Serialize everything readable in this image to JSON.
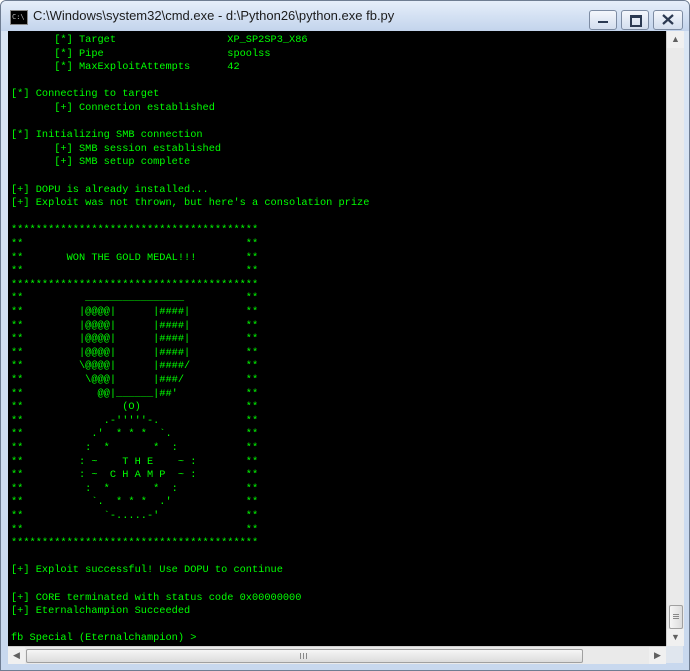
{
  "window": {
    "title": "C:\\Windows\\system32\\cmd.exe - d:\\Python26\\python.exe  fb.py",
    "icon_text": "C:\\",
    "controls": [
      "minimize-icon",
      "maximize-icon",
      "close-icon"
    ]
  },
  "colors": {
    "console_bg": "#000000",
    "console_text": "#00ff00"
  },
  "console": {
    "lines": [
      "       [*] Target                  XP_SP2SP3_X86",
      "       [*] Pipe                    spoolss",
      "       [*] MaxExploitAttempts      42",
      "",
      "[*] Connecting to target",
      "       [+] Connection established",
      "",
      "[*] Initializing SMB connection",
      "       [+] SMB session established",
      "       [+] SMB setup complete",
      "",
      "[+] DOPU is already installed...",
      "[+] Exploit was not thrown, but here's a consolation prize",
      "",
      "****************************************",
      "**                                    **",
      "**       WON THE GOLD MEDAL!!!        **",
      "**                                    **",
      "****************************************",
      "**          ________________          **",
      "**         |@@@@|      |####|         **",
      "**         |@@@@|      |####|         **",
      "**         |@@@@|      |####|         **",
      "**         |@@@@|      |####|         **",
      "**         \\@@@@|      |####/         **",
      "**          \\@@@|      |###/          **",
      "**            @@|______|##'           **",
      "**                (O)                 **",
      "**             .-'''''-.              **",
      "**           .'  * * *  `.            **",
      "**          :  *       *  :           **",
      "**         : ~    T H E    ~ :        **",
      "**         : ~  C H A M P  ~ :        **",
      "**          :  *       *  :           **",
      "**           `.  * * *  .'            **",
      "**             `-.....-'              **",
      "**                                    **",
      "****************************************",
      "",
      "[+] Exploit successful! Use DOPU to continue",
      "",
      "[+] CORE terminated with status code 0x00000000",
      "[+] Eternalchampion Succeeded",
      "",
      "fb Special (Eternalchampion) >"
    ]
  },
  "scrollbars": {
    "vertical": {
      "up": "▲",
      "down": "▼"
    },
    "horizontal": {
      "left": "◀",
      "right": "▶"
    }
  }
}
